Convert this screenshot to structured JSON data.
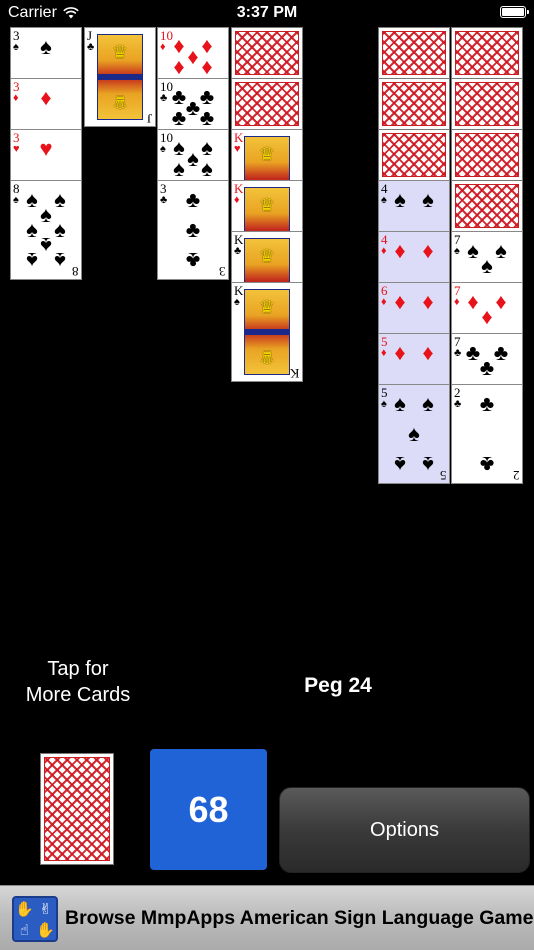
{
  "status_bar": {
    "carrier": "Carrier",
    "time": "3:37 PM"
  },
  "tableau": {
    "col1": [
      {
        "rank": "3",
        "suit": "♠",
        "color": "black"
      },
      {
        "rank": "3",
        "suit": "♦",
        "color": "red"
      },
      {
        "rank": "3",
        "suit": "♥",
        "color": "red"
      },
      {
        "rank": "8",
        "suit": "♠",
        "color": "black"
      }
    ],
    "col2": [
      {
        "rank": "J",
        "suit": "♣",
        "color": "black"
      }
    ],
    "col3": [
      {
        "rank": "10",
        "suit": "♦",
        "color": "red"
      },
      {
        "rank": "10",
        "suit": "♣",
        "color": "black"
      },
      {
        "rank": "10",
        "suit": "♠",
        "color": "black"
      },
      {
        "rank": "3",
        "suit": "♣",
        "color": "black"
      }
    ],
    "col4": [
      {
        "face_down": true
      },
      {
        "face_down": true
      },
      {
        "rank": "K",
        "suit": "♥",
        "color": "red"
      },
      {
        "rank": "K",
        "suit": "♦",
        "color": "red"
      },
      {
        "rank": "K",
        "suit": "♣",
        "color": "black"
      },
      {
        "rank": "K",
        "suit": "♠",
        "color": "black"
      }
    ],
    "col5": [
      {
        "face_down": true
      },
      {
        "face_down": true
      },
      {
        "face_down": true
      },
      {
        "rank": "4",
        "suit": "♠",
        "color": "black"
      },
      {
        "rank": "4",
        "suit": "♦",
        "color": "red"
      },
      {
        "rank": "6",
        "suit": "♦",
        "color": "red"
      },
      {
        "rank": "5",
        "suit": "♦",
        "color": "red"
      },
      {
        "rank": "5",
        "suit": "♠",
        "color": "black"
      }
    ],
    "col6": [
      {
        "face_down": true
      },
      {
        "face_down": true
      },
      {
        "face_down": true
      },
      {
        "face_down": true
      },
      {
        "rank": "7",
        "suit": "♠",
        "color": "black"
      },
      {
        "rank": "7",
        "suit": "♦",
        "color": "red"
      },
      {
        "rank": "7",
        "suit": "♣",
        "color": "black"
      },
      {
        "rank": "2",
        "suit": "♣",
        "color": "black"
      }
    ]
  },
  "controls": {
    "tap_line1": "Tap for",
    "tap_line2": "More Cards",
    "peg_label": "Peg 24",
    "score": "68",
    "options_label": "Options"
  },
  "ad": {
    "text": "Browse MmpApps American Sign Language Games",
    "icon": "sign-language-hands-icon"
  },
  "colors": {
    "background": "#000000",
    "card_red": "#e8121a",
    "score_blue": "#1f63d6",
    "card_back_red": "#c81e24",
    "highlight_tint": "#dcdcf8"
  }
}
